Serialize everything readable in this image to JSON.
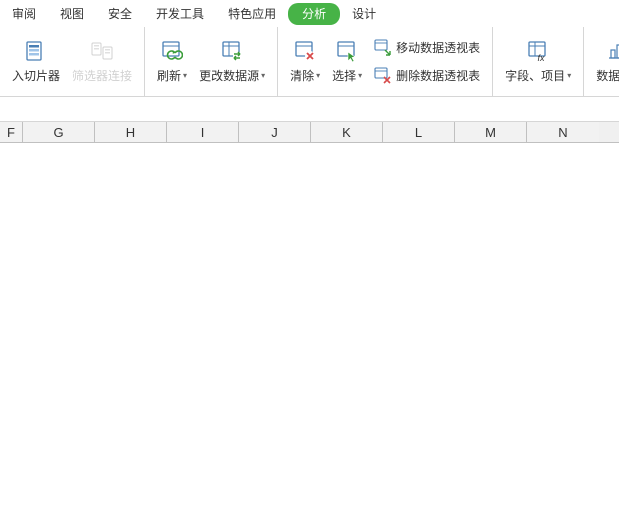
{
  "tabs": {
    "review": "审阅",
    "view": "视图",
    "security": "安全",
    "devtools": "开发工具",
    "special": "特色应用",
    "analysis": "分析",
    "design": "设计"
  },
  "ribbon": {
    "insert_slicer": "入切片器",
    "filter_connect": "筛选器连接",
    "refresh": "刷新",
    "change_source": "更改数据源",
    "clear": "清除",
    "select": "选择",
    "move_pivot": "移动数据透视表",
    "delete_pivot": "删除数据透视表",
    "fields_items": "字段、项目",
    "pivot_view": "数据透视"
  },
  "columns": [
    "F",
    "G",
    "H",
    "I",
    "J",
    "K",
    "L",
    "M",
    "N"
  ]
}
